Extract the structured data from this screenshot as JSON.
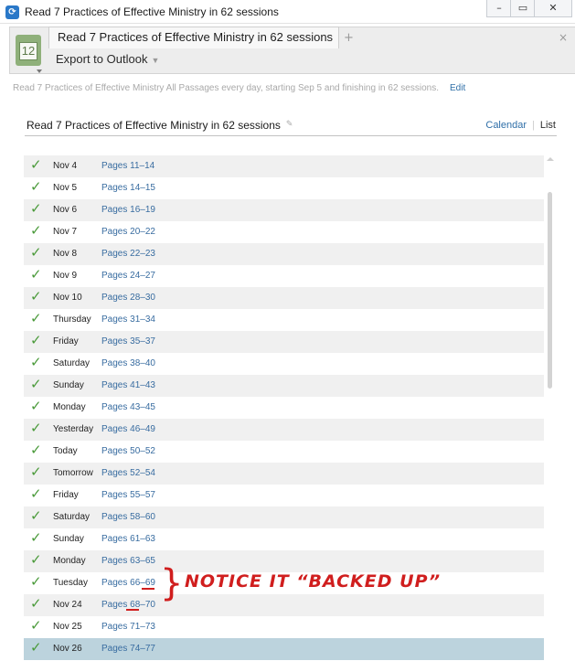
{
  "window": {
    "title": "Read 7 Practices of Effective Ministry in 62 sessions",
    "icon": "app-icon",
    "controls": [
      "minimize-icon",
      "maximize-icon",
      "close-icon"
    ]
  },
  "tabs": {
    "active_label": "Read 7 Practices of Effective Ministry in 62 sessions",
    "add_label": "+",
    "close_label": "×",
    "calendar_icon_number": "12"
  },
  "toolbar": {
    "export_label": "Export to Outlook"
  },
  "plan": {
    "description": "Read 7 Practices of Effective Ministry All Passages every day, starting Sep 5 and finishing in 62 sessions.",
    "edit_label": "Edit",
    "title": "Read 7 Practices of Effective Ministry in 62 sessions",
    "view_calendar": "Calendar",
    "view_list": "List"
  },
  "sessions": [
    {
      "day": "Nov 4",
      "pages": "Pages 11–14",
      "completed": true
    },
    {
      "day": "Nov 5",
      "pages": "Pages 14–15",
      "completed": true
    },
    {
      "day": "Nov 6",
      "pages": "Pages 16–19",
      "completed": true
    },
    {
      "day": "Nov 7",
      "pages": "Pages 20–22",
      "completed": true
    },
    {
      "day": "Nov 8",
      "pages": "Pages 22–23",
      "completed": true
    },
    {
      "day": "Nov 9",
      "pages": "Pages 24–27",
      "completed": true
    },
    {
      "day": "Nov 10",
      "pages": "Pages 28–30",
      "completed": true
    },
    {
      "day": "Thursday",
      "pages": "Pages 31–34",
      "completed": true
    },
    {
      "day": "Friday",
      "pages": "Pages 35–37",
      "completed": true
    },
    {
      "day": "Saturday",
      "pages": "Pages 38–40",
      "completed": true
    },
    {
      "day": "Sunday",
      "pages": "Pages 41–43",
      "completed": true
    },
    {
      "day": "Monday",
      "pages": "Pages 43–45",
      "completed": true
    },
    {
      "day": "Yesterday",
      "pages": "Pages 46–49",
      "completed": true
    },
    {
      "day": "Today",
      "pages": "Pages 50–52",
      "completed": true
    },
    {
      "day": "Tomorrow",
      "pages": "Pages 52–54",
      "completed": true
    },
    {
      "day": "Friday",
      "pages": "Pages 55–57",
      "completed": true
    },
    {
      "day": "Saturday",
      "pages": "Pages 58–60",
      "completed": true
    },
    {
      "day": "Sunday",
      "pages": "Pages 61–63",
      "completed": true
    },
    {
      "day": "Monday",
      "pages": "Pages 63–65",
      "completed": true
    },
    {
      "day": "Tuesday",
      "pages": "Pages 66–69",
      "completed": true
    },
    {
      "day": "Nov 24",
      "pages": "Pages 68–70",
      "completed": true
    },
    {
      "day": "Nov 25",
      "pages": "Pages 71–73",
      "completed": true
    },
    {
      "day": "Nov 26",
      "pages": "Pages 74–77",
      "completed": true,
      "selected": true
    }
  ],
  "annotation": {
    "brace": "}",
    "text": "NOTICE IT “BACKED UP”",
    "color": "#d01e1e"
  },
  "colors": {
    "link": "#386ca0",
    "check": "#4a9a3a",
    "selected_row": "#bcd3dd"
  }
}
